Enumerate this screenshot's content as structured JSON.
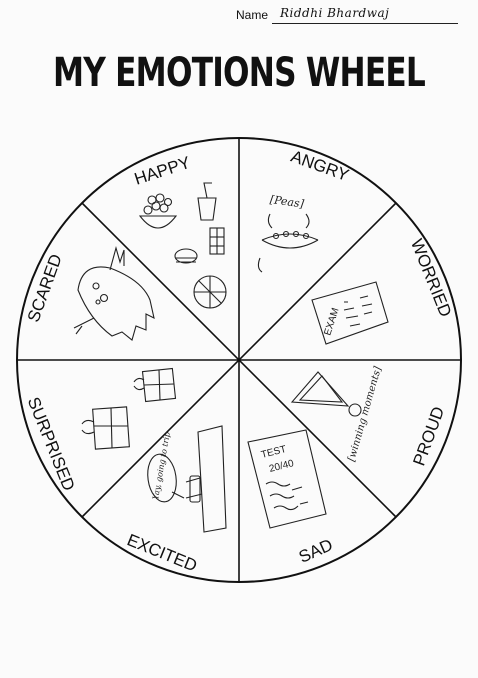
{
  "header": {
    "name_label": "Name",
    "name_value": "Riddhi Bhardwaj"
  },
  "title": "MY EMOTIONS WHEEL",
  "wheel": {
    "segments": [
      {
        "label": "HAPPY"
      },
      {
        "label": "ANGRY"
      },
      {
        "label": "WORRIED"
      },
      {
        "label": "PROUD"
      },
      {
        "label": "SAD"
      },
      {
        "label": "EXCITED"
      },
      {
        "label": "SURPRISED"
      },
      {
        "label": "SCARED"
      }
    ],
    "drawing_texts": {
      "peas": "[Peas]",
      "exam": "EXAM",
      "winning_moments": "[winning moments]",
      "test": "TEST",
      "score": "20/40",
      "speech": "Yay, going to trip"
    }
  }
}
